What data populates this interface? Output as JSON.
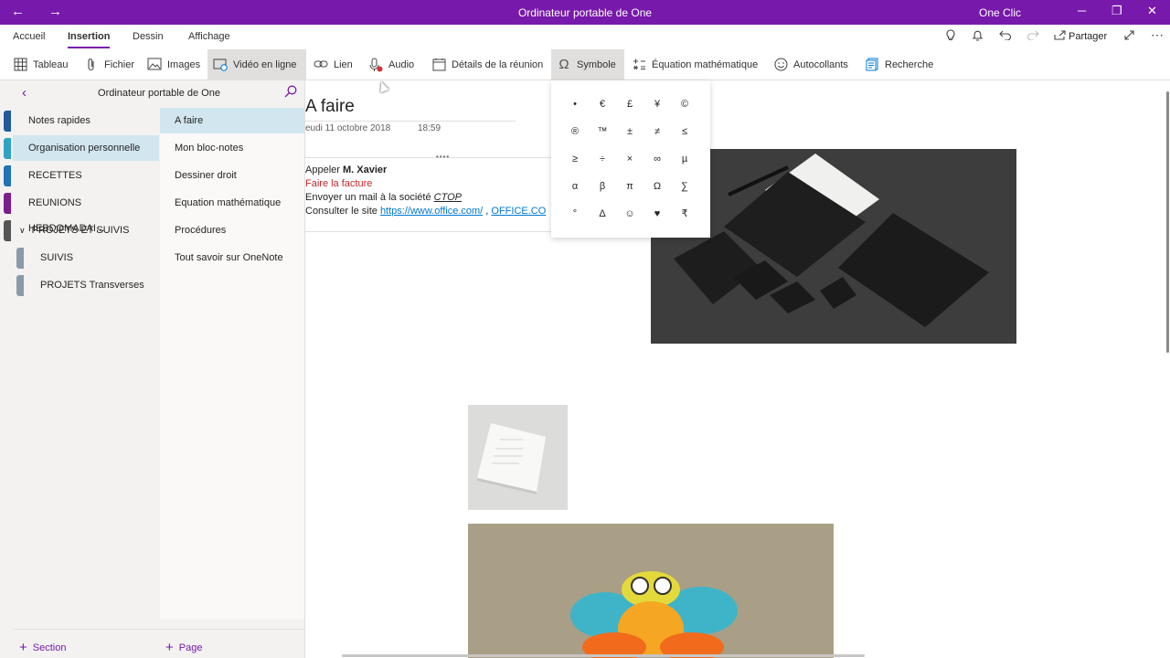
{
  "titlebar": {
    "back_icon": "arrow-left-icon",
    "forward_icon": "arrow-right-icon",
    "title": "Ordinateur portable de One",
    "user": "One Clic",
    "minimize": "─",
    "restore": "❐",
    "close": "✕"
  },
  "menubar": {
    "tabs": [
      "Accueil",
      "Insertion",
      "Dessin",
      "Affichage"
    ],
    "active_tab": "Insertion",
    "share_label": "Partager"
  },
  "ribbon": {
    "buttons": [
      {
        "label": "Tableau",
        "icon": "table-icon"
      },
      {
        "label": "Fichier",
        "icon": "paperclip-icon"
      },
      {
        "label": "Images",
        "icon": "image-icon"
      },
      {
        "label": "Vidéo en ligne",
        "icon": "online-video-icon"
      },
      {
        "label": "Lien",
        "icon": "link-icon"
      },
      {
        "label": "Audio",
        "icon": "microphone-icon"
      },
      {
        "label": "Détails de la réunion",
        "icon": "calendar-icon"
      },
      {
        "label": "Symbole",
        "icon": "omega-icon"
      },
      {
        "label": "Équation mathématique",
        "icon": "equation-icon"
      },
      {
        "label": "Autocollants",
        "icon": "smiley-icon"
      },
      {
        "label": "Recherche",
        "icon": "researcher-icon"
      }
    ]
  },
  "sidebar": {
    "notebook_name": "Ordinateur portable de One",
    "sections": [
      {
        "label": "Notes rapides",
        "color": "#1f5c99"
      },
      {
        "label": "Organisation personnelle",
        "color": "#2ea3c5"
      },
      {
        "label": "RECETTES",
        "color": "#1f73b7"
      },
      {
        "label": "REUNIONS HEBDOMADAI...",
        "color": "#7a1d8f"
      },
      {
        "label": "PROJETS ET SUIVIS",
        "color": "#555555"
      },
      {
        "label": "SUIVIS",
        "color": "#8a9aa8"
      },
      {
        "label": "PROJETS Transverses",
        "color": "#8a9aa8"
      }
    ],
    "pages": [
      "A faire",
      "Mon bloc-notes",
      "Dessiner droit",
      "Equation mathématique",
      "Procédures",
      "Tout savoir sur OneNote"
    ],
    "add_section": "Section",
    "add_page": "Page"
  },
  "page": {
    "title": "A faire",
    "date": "eudi 11 octobre 2018",
    "time": "18:59",
    "lines": {
      "l1_pre": "Appeler ",
      "l1_bold": "M. Xavier",
      "l2": "Faire la facture",
      "l3_pre": "Envoyer un mail à la société ",
      "l3_em": "CTOP",
      "l4_pre": "Consulter le site ",
      "l4_link1": "https://www.office.com/",
      "l4_sep": " , ",
      "l4_link2": "OFFICE.CO"
    }
  },
  "symbols": [
    "•",
    "€",
    "£",
    "¥",
    "©",
    "®",
    "™",
    "±",
    "≠",
    "≤",
    "≥",
    "÷",
    "×",
    "∞",
    "µ",
    "α",
    "β",
    "π",
    "Ω",
    "∑",
    "°",
    "Δ",
    "☺",
    "♥",
    "₹"
  ],
  "colors": {
    "accent": "#7719aa",
    "link": "#0078d4",
    "red_text": "#c4262b",
    "selection": "#d2e6f0"
  }
}
